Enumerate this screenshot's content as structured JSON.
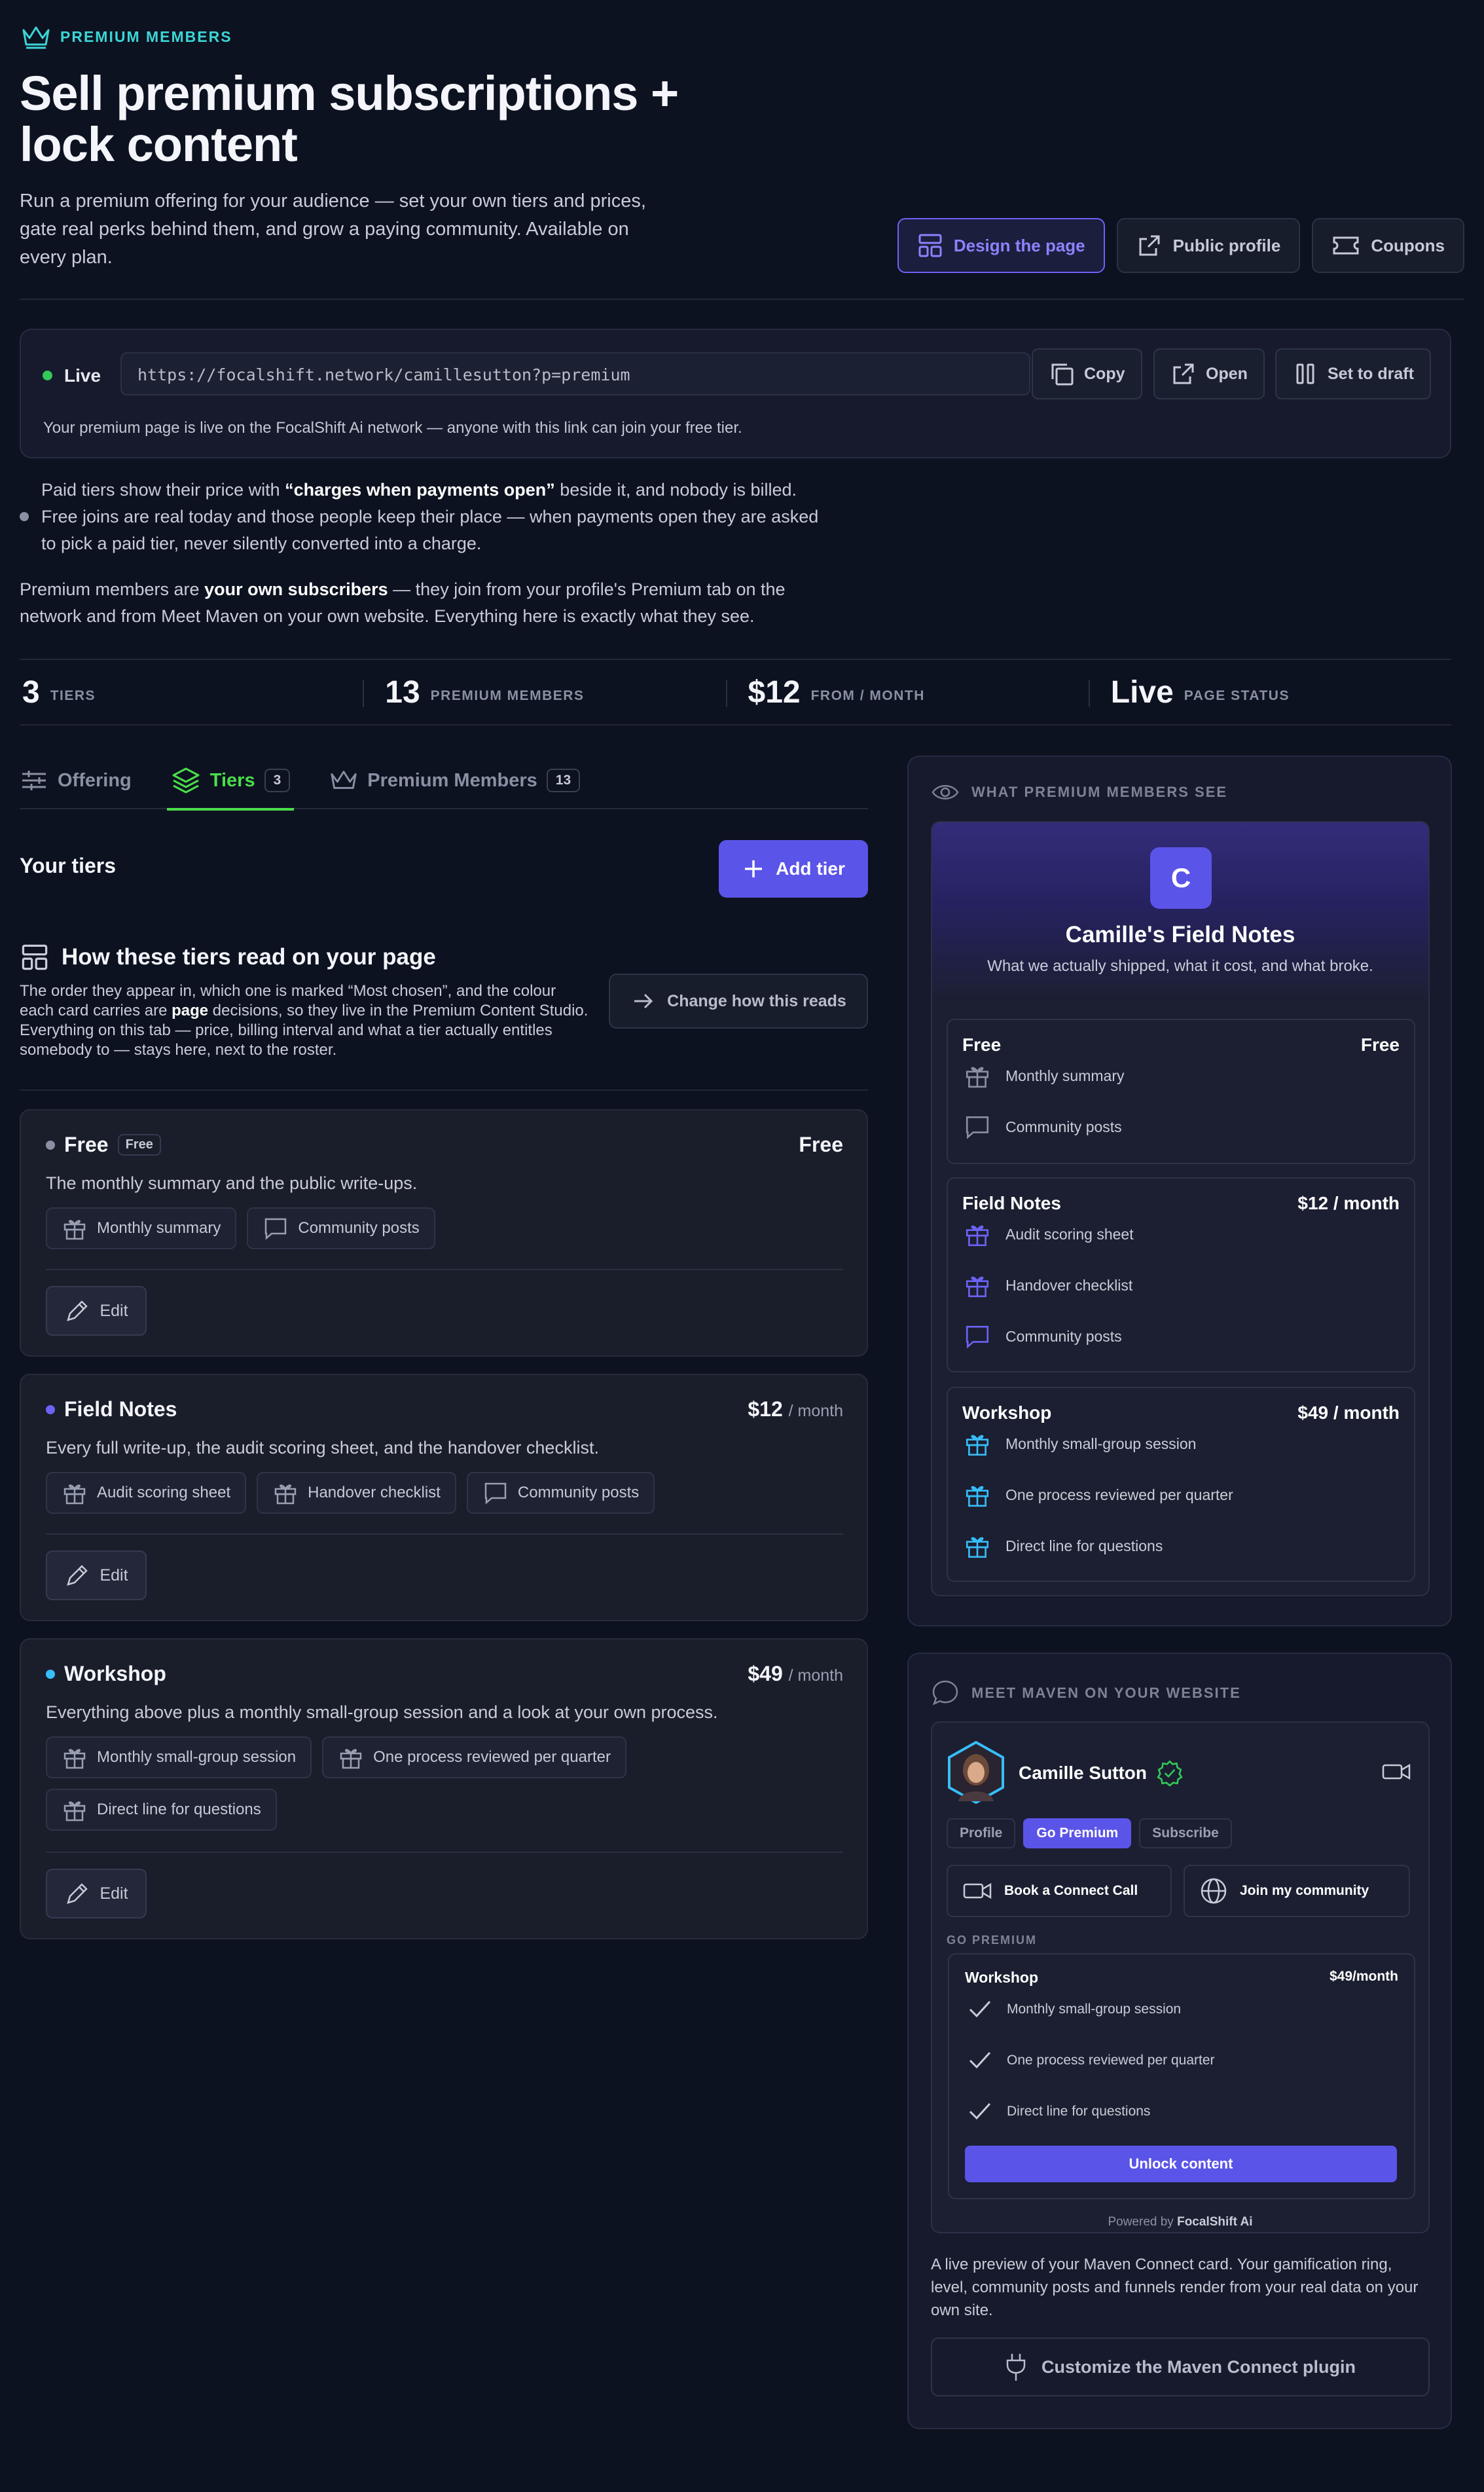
{
  "header": {
    "eyebrow": "PREMIUM MEMBERS",
    "title": "Sell premium subscriptions + lock content",
    "intro": "Run a premium offering for your audience — set your own tiers and prices, gate real perks behind them, and grow a paying community. Available on every plan.",
    "buttons": {
      "design": "Design the page",
      "public": "Public profile",
      "coupons": "Coupons"
    }
  },
  "live": {
    "status": "Live",
    "url": "https://focalshift.network/camillesutton?p=premium",
    "copy": "Copy",
    "open": "Open",
    "draft": "Set to draft",
    "note": "Your premium page is live on the FocalShift Ai network — anyone with this link can join your free tier."
  },
  "notice": {
    "pre": "Paid tiers show their price with ",
    "bold": "“charges when payments open”",
    "post": " beside it, and nobody is billed. Free joins are real today and those people keep their place — when payments open they are asked to pick a paid tier, never silently converted into a charge."
  },
  "para": {
    "pre": "Premium members are ",
    "bold": "your own subscribers",
    "post": " — they join from your profile's Premium tab on the network and from Meet Maven on your own website. Everything here is exactly what they see."
  },
  "stats": [
    {
      "value": "3",
      "label": "TIERS"
    },
    {
      "value": "13",
      "label": "PREMIUM MEMBERS"
    },
    {
      "value": "$12",
      "label": "FROM / MONTH"
    },
    {
      "value": "Live",
      "label": "PAGE STATUS"
    }
  ],
  "tabs": [
    {
      "label": "Offering"
    },
    {
      "label": "Tiers",
      "count": "3"
    },
    {
      "label": "Premium Members",
      "count": "13"
    }
  ],
  "tiers_section": {
    "title": "Your tiers",
    "add": "Add tier",
    "how_title": "How these tiers read on your page",
    "how_pre": "The order they appear in, which one is marked “Most chosen”, and the colour each card carries are ",
    "how_bold": "page",
    "how_post": " decisions, so they live in the Premium Content Studio. Everything on this tab — price, billing interval and what a tier actually entitles somebody to — stays here, next to the roster.",
    "change": "Change how this reads",
    "edit": "Edit"
  },
  "tiers": [
    {
      "name": "Free",
      "badge": "Free",
      "price": "Free",
      "unit": "",
      "color": "#8a8fa3",
      "desc": "The monthly summary and the public write-ups.",
      "perks": [
        "Monthly summary",
        "Community posts"
      ]
    },
    {
      "name": "Field Notes",
      "price": "$12",
      "unit": "/ month",
      "color": "#6c63f5",
      "desc": "Every full write-up, the audit scoring sheet, and the handover checklist.",
      "perks": [
        "Audit scoring sheet",
        "Handover checklist",
        "Community posts"
      ]
    },
    {
      "name": "Workshop",
      "price": "$49",
      "unit": "/ month",
      "color": "#38bdf8",
      "desc": "Everything above plus a monthly small-group session and a look at your own process.",
      "perks": [
        "Monthly small-group session",
        "One process reviewed per quarter",
        "Direct line for questions"
      ]
    }
  ],
  "preview": {
    "title": "WHAT PREMIUM MEMBERS SEE",
    "avatar": "C",
    "name": "Camille's Field Notes",
    "subtitle": "What we actually shipped, what it cost, and what broke.",
    "tiers": [
      {
        "name": "Free",
        "price": "Free",
        "perks": [
          "Monthly summary",
          "Community posts"
        ]
      },
      {
        "name": "Field Notes",
        "price": "$12 / month",
        "perks": [
          "Audit scoring sheet",
          "Handover checklist",
          "Community posts"
        ]
      },
      {
        "name": "Workshop",
        "price": "$49 / month",
        "perks": [
          "Monthly small-group session",
          "One process reviewed per quarter",
          "Direct line for questions"
        ]
      }
    ]
  },
  "maven": {
    "title": "MEET MAVEN ON YOUR WEBSITE",
    "name": "Camille Sutton",
    "pills": [
      "Profile",
      "Go Premium",
      "Subscribe"
    ],
    "book": "Book a Connect Call",
    "join": "Join my community",
    "go_premium": "GO PREMIUM",
    "tier": "Workshop",
    "price": "$49/month",
    "perks": [
      "Monthly small-group session",
      "One process reviewed per quarter",
      "Direct line for questions"
    ],
    "unlock": "Unlock content",
    "powered_pre": "Powered by ",
    "powered_brand": "FocalShift Ai",
    "note": "A live preview of your Maven Connect card. Your gamification ring, level, community posts and funnels render from your real data on your own site.",
    "customize": "Customize the Maven Connect plugin"
  }
}
